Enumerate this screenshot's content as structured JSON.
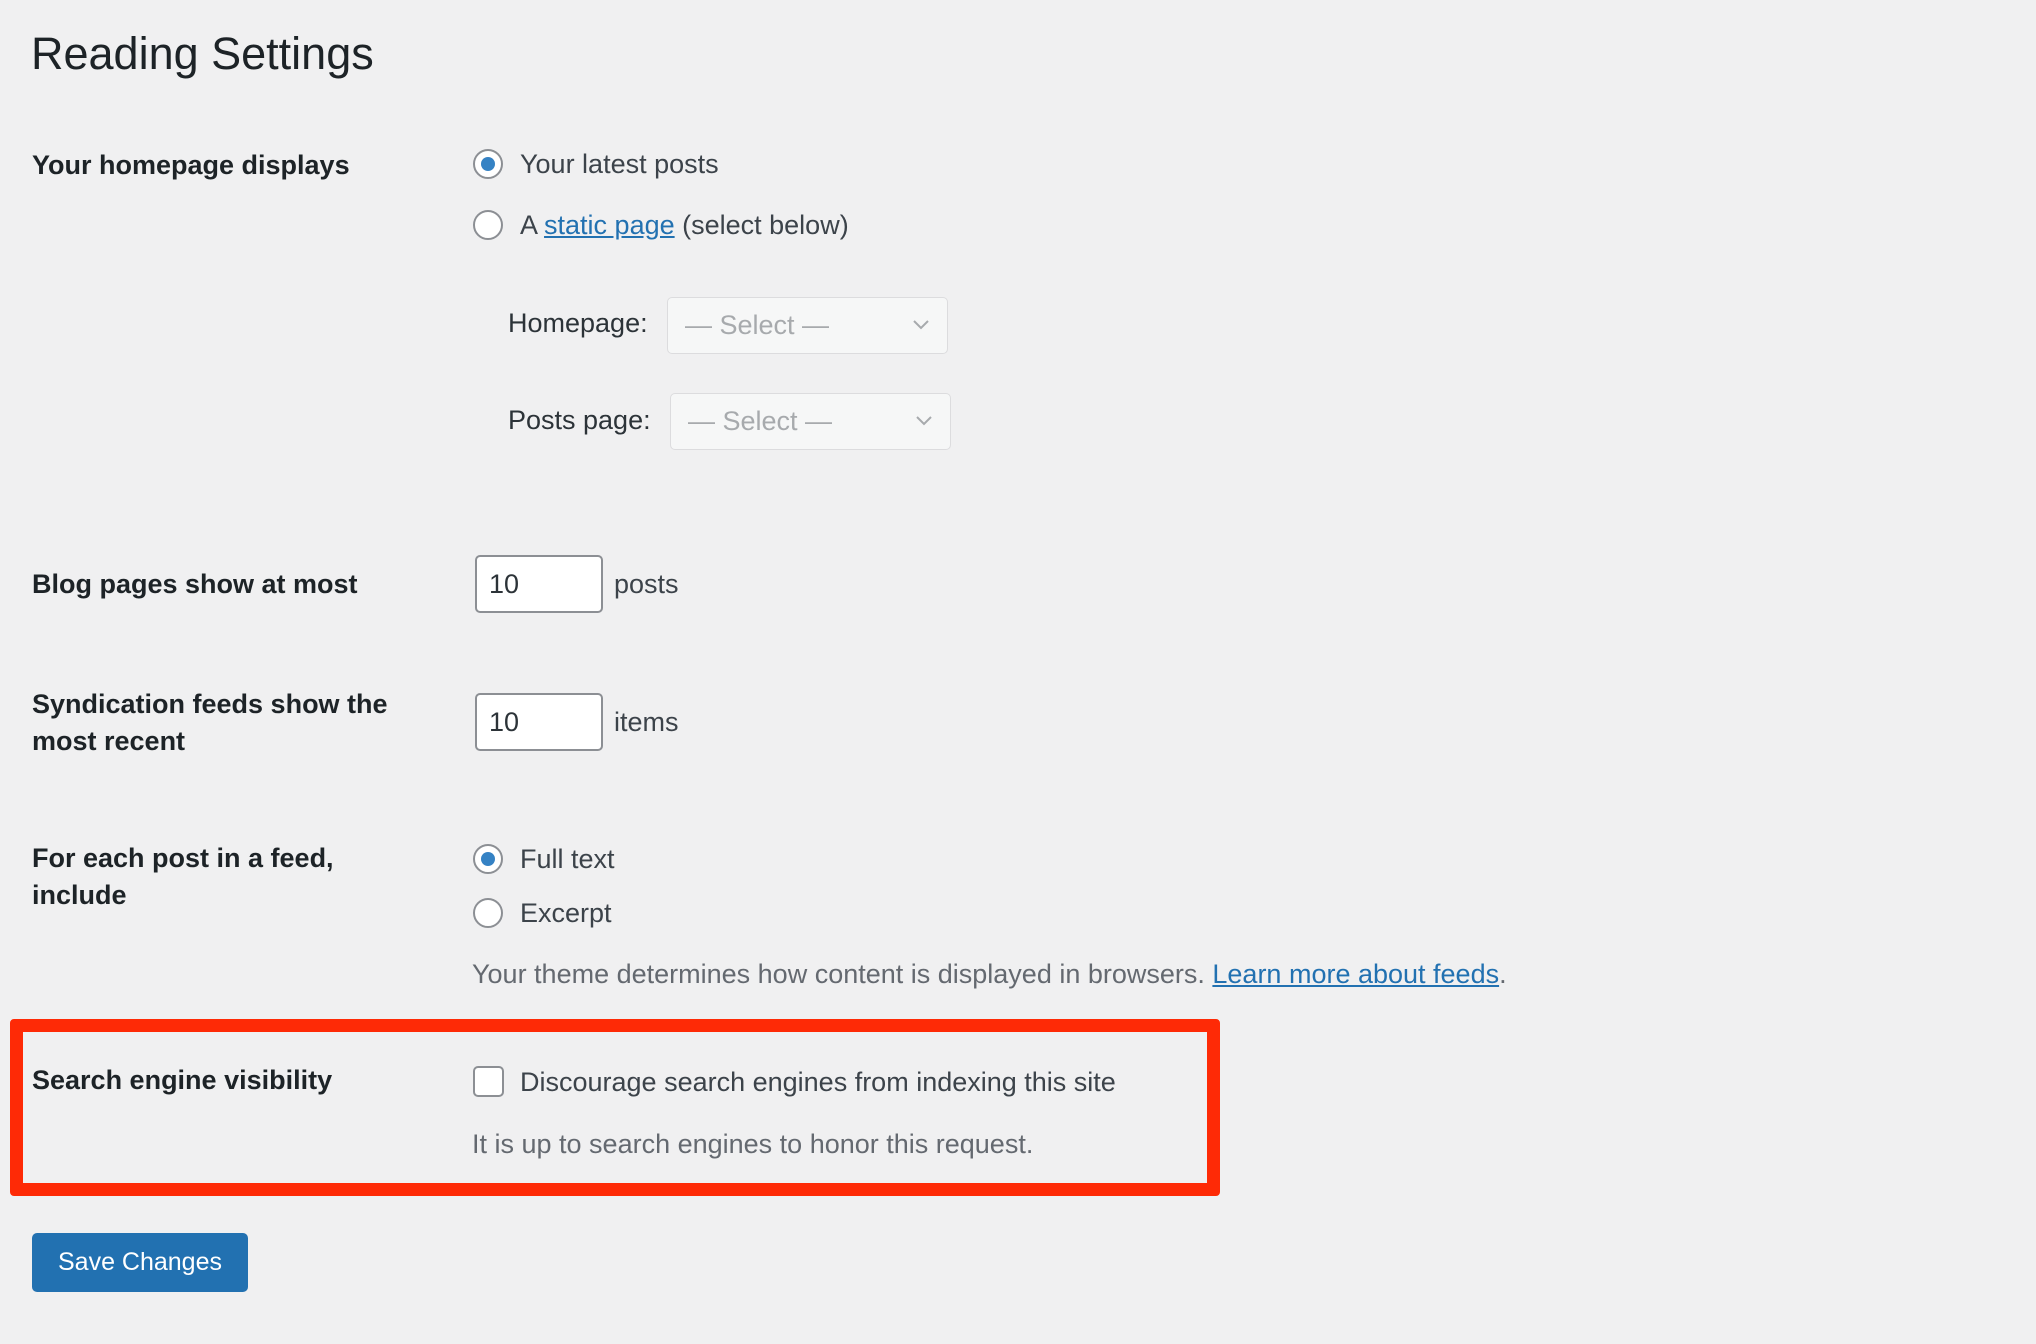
{
  "page": {
    "title": "Reading Settings"
  },
  "homepage_displays": {
    "label": "Your homepage displays",
    "options": [
      {
        "label": "Your latest posts",
        "checked": true
      },
      {
        "prefix": "A ",
        "link": "static page",
        "suffix": " (select below)",
        "checked": false
      }
    ],
    "homepage": {
      "label": "Homepage:",
      "value": "— Select —"
    },
    "posts_page": {
      "label": "Posts page:",
      "value": "— Select —"
    }
  },
  "blog_pages": {
    "label": "Blog pages show at most",
    "value": "10",
    "unit": "posts"
  },
  "syndication": {
    "label_line1": "Syndication feeds show the",
    "label_line2": "most recent",
    "value": "10",
    "unit": "items"
  },
  "feed_content": {
    "label_line1": "For each post in a feed,",
    "label_line2": "include",
    "options": [
      {
        "label": "Full text",
        "checked": true
      },
      {
        "label": "Excerpt",
        "checked": false
      }
    ],
    "description": "Your theme determines how content is displayed in browsers. ",
    "link": "Learn more about feeds",
    "period": "."
  },
  "search_visibility": {
    "label": "Search engine visibility",
    "checkbox_label": "Discourage search engines from indexing this site",
    "checked": false,
    "description": "It is up to search engines to honor this request."
  },
  "actions": {
    "save_label": "Save Changes"
  },
  "colors": {
    "accent": "#2271b1",
    "radio_dot": "#3582c4",
    "highlight": "#fe2a06",
    "background": "#f0f0f1"
  }
}
